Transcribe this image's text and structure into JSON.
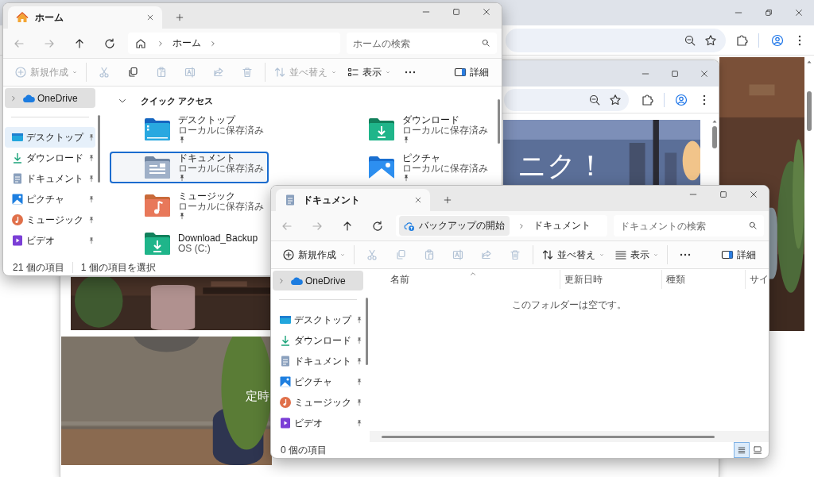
{
  "web_browser": {
    "hero_text": "ニク！",
    "banner_text": "定時"
  },
  "home_window": {
    "tab": {
      "kind": "home",
      "title": "ホーム"
    },
    "nav_buttons": [
      {
        "kind": "back",
        "disabled": true
      },
      {
        "kind": "forward",
        "disabled": true
      },
      {
        "kind": "up",
        "disabled": false
      },
      {
        "kind": "refresh",
        "disabled": false
      }
    ],
    "address": {
      "kind": "home",
      "segments": [
        "ホーム"
      ],
      "trailing_chevron": true
    },
    "search": {
      "placeholder": "ホームの検索"
    },
    "command_groups": [
      [
        {
          "kind": "new",
          "label": "新規作成",
          "disabled": true
        }
      ],
      [
        {
          "kind": "cut",
          "disabled": true
        },
        {
          "kind": "copy",
          "disabled": false
        },
        {
          "kind": "paste",
          "disabled": true
        },
        {
          "kind": "rename",
          "disabled": true
        },
        {
          "kind": "share",
          "disabled": true
        },
        {
          "kind": "delete",
          "disabled": true
        }
      ],
      [
        {
          "kind": "sort",
          "label": "並べ替え",
          "disabled": true
        },
        {
          "kind": "view-tiles",
          "label": "表示",
          "disabled": false
        },
        {
          "kind": "more",
          "disabled": false
        }
      ]
    ],
    "details_button": {
      "label": "詳細"
    },
    "nav_roots": [
      {
        "label": "OneDrive",
        "kind": "cloud",
        "expanded": false,
        "selected": true
      }
    ],
    "nav_quick": [
      {
        "label": "デスクトップ",
        "kind": "desktop",
        "pinned": true,
        "selected": false,
        "hovered": true
      },
      {
        "label": "ダウンロード",
        "kind": "downloads",
        "pinned": true,
        "selected": false,
        "hovered": false
      },
      {
        "label": "ドキュメント",
        "kind": "documents",
        "pinned": true,
        "selected": false,
        "hovered": false
      },
      {
        "label": "ピクチャ",
        "kind": "pictures",
        "pinned": true,
        "selected": false,
        "hovered": false
      },
      {
        "label": "ミュージック",
        "kind": "music",
        "pinned": true,
        "selected": false,
        "hovered": false
      },
      {
        "label": "ビデオ",
        "kind": "videos",
        "pinned": true,
        "selected": false,
        "hovered": false
      }
    ],
    "content": {
      "kind": "quick_access",
      "section": {
        "title": "クイック アクセス",
        "expanded": true
      },
      "rows": [
        [
          {
            "name": "デスクトップ",
            "detail": "ローカルに保存済み",
            "kind": "desktop",
            "pinned": true,
            "selected": false
          },
          {
            "name": "ダウンロード",
            "detail": "ローカルに保存済み",
            "kind": "downloads",
            "pinned": true,
            "selected": false
          }
        ],
        [
          {
            "name": "ドキュメント",
            "detail": "ローカルに保存済み",
            "kind": "documents",
            "pinned": true,
            "selected": true
          },
          {
            "name": "ピクチャ",
            "detail": "ローカルに保存済み",
            "kind": "pictures",
            "pinned": true,
            "selected": false
          }
        ],
        [
          {
            "name": "ミュージック",
            "detail": "ローカルに保存済み",
            "kind": "music",
            "pinned": true,
            "selected": false
          }
        ],
        [
          {
            "name": "Download_Backup",
            "detail": "OS (C:)",
            "kind": "downloads",
            "pinned": false,
            "selected": false
          }
        ]
      ]
    },
    "status": [
      "21 個の項目",
      "1 個の項目を選択"
    ]
  },
  "docs_window": {
    "tab": {
      "kind": "documents",
      "title": "ドキュメント"
    },
    "nav_buttons": [
      {
        "kind": "back",
        "disabled": true
      },
      {
        "kind": "forward",
        "disabled": true
      },
      {
        "kind": "up",
        "disabled": false
      },
      {
        "kind": "refresh",
        "disabled": false
      }
    ],
    "address": {
      "kind": "backup",
      "label": "バックアップの開始",
      "segments": [
        "ドキュメント"
      ],
      "trailing_chevron": false
    },
    "search": {
      "placeholder": "ドキュメントの検索"
    },
    "command_groups": [
      [
        {
          "kind": "new",
          "label": "新規作成",
          "disabled": false
        }
      ],
      [
        {
          "kind": "cut",
          "disabled": true
        },
        {
          "kind": "copy",
          "disabled": true
        },
        {
          "kind": "paste",
          "disabled": true
        },
        {
          "kind": "rename",
          "disabled": true
        },
        {
          "kind": "share",
          "disabled": true
        },
        {
          "kind": "delete",
          "disabled": true
        }
      ],
      [
        {
          "kind": "sort",
          "label": "並べ替え",
          "disabled": false
        },
        {
          "kind": "view-list",
          "label": "表示",
          "disabled": false
        }
      ],
      [
        {
          "kind": "more",
          "disabled": false
        }
      ]
    ],
    "details_button": {
      "label": "詳細"
    },
    "nav_roots": [
      {
        "label": "OneDrive",
        "kind": "cloud",
        "expanded": false,
        "selected": true
      }
    ],
    "nav_quick": [
      {
        "label": "デスクトップ",
        "kind": "desktop",
        "pinned": true,
        "selected": false,
        "hovered": false
      },
      {
        "label": "ダウンロード",
        "kind": "downloads",
        "pinned": true,
        "selected": false,
        "hovered": false
      },
      {
        "label": "ドキュメント",
        "kind": "documents",
        "pinned": true,
        "selected": false,
        "hovered": false
      },
      {
        "label": "ピクチャ",
        "kind": "pictures",
        "pinned": true,
        "selected": false,
        "hovered": false
      },
      {
        "label": "ミュージック",
        "kind": "music",
        "pinned": true,
        "selected": false,
        "hovered": false
      },
      {
        "label": "ビデオ",
        "kind": "videos",
        "pinned": true,
        "selected": false,
        "hovered": false
      }
    ],
    "content": {
      "kind": "details",
      "columns": [
        {
          "label": "名前",
          "sorted": true
        },
        {
          "label": "更新日時",
          "sorted": false
        },
        {
          "label": "種類",
          "sorted": false
        },
        {
          "label": "サイ",
          "sorted": false
        }
      ],
      "empty_message": "このフォルダーは空です。"
    },
    "status": [
      "0 個の項目"
    ],
    "views": [
      {
        "kind": "details",
        "selected": true
      },
      {
        "kind": "tiles",
        "selected": false
      }
    ]
  }
}
